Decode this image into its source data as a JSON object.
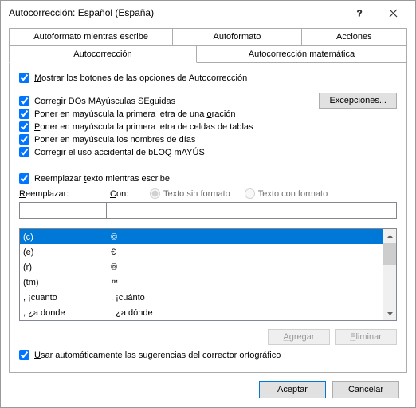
{
  "title": "Autocorrección: Español (España)",
  "tabs": {
    "autoformat_typing": "Autoformato mientras escribe",
    "autoformat": "Autoformato",
    "actions": "Acciones",
    "autocorrect": "Autocorrección",
    "math_autocorrect": "Autocorrección matemática"
  },
  "checks": {
    "show_buttons": "ostrar los botones de las opciones de Autocorrección",
    "two_caps": "Corregir DOs MAyúsculas SEguidas",
    "sentence_cap": "Poner en mayúscula la primera letra de una ",
    "sentence_cap2": "ración",
    "cell_cap_pre": "oner en mayúscula la primera letra de celdas de tablas",
    "day_names": "Poner en mayúscula los nombres de días",
    "caps_lock_pre": "Corregir el uso accidental de ",
    "caps_lock_mid": "LOQ mAYÚS",
    "replace_typing_pre": "Reemplazar ",
    "replace_typing_mid": "exto mientras escribe",
    "auto_suggest_pre": "sar automáticamente las sugerencias del corrector ortográfico"
  },
  "labels": {
    "replace": "eemplazar:",
    "with": "on:",
    "plain_text": "Texto sin formato",
    "formatted_text": "Texto con formato"
  },
  "buttons": {
    "exceptions": "Excepciones...",
    "add": "Agregar",
    "delete": "Eliminar",
    "ok": "Aceptar",
    "cancel": "Cancelar"
  },
  "input": {
    "replace_value": "",
    "with_value": ""
  },
  "list": [
    {
      "from": "(c)",
      "to": "©"
    },
    {
      "from": "(e)",
      "to": "€"
    },
    {
      "from": "(r)",
      "to": "®"
    },
    {
      "from": "(tm)",
      "to": "™"
    },
    {
      "from": ", ¡cuanto",
      "to": ", ¡cuánto"
    },
    {
      "from": ", ¿a donde",
      "to": ", ¿a dónde"
    }
  ]
}
